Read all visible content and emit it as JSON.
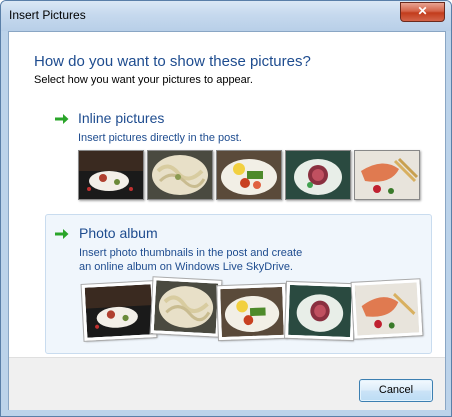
{
  "window": {
    "title": "Insert Pictures",
    "close_glyph": "✕"
  },
  "dialog": {
    "heading": "How do you want to show these pictures?",
    "subheading": "Select how you want your pictures to appear."
  },
  "options": [
    {
      "title": "Inline pictures",
      "description": "Insert pictures directly in the post.",
      "selected": false
    },
    {
      "title": "Photo album",
      "description": "Insert photo thumbnails in the post and create an online album on Windows Live SkyDrive.",
      "description_line1": "Insert photo thumbnails in the post and create",
      "description_line2": "an online album on Windows Live SkyDrive.",
      "selected": true
    }
  ],
  "icons": {
    "option_arrow": "green-arrow-icon"
  },
  "footer": {
    "cancel_label": "Cancel"
  },
  "colors": {
    "accent": "#1e4c8f",
    "arrow": "#2aa52a",
    "selected_bg": "#f0f6fc"
  }
}
